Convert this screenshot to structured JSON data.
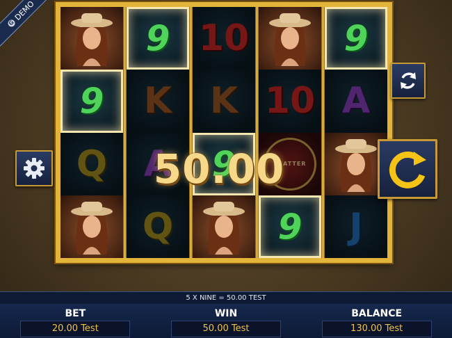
{
  "demo": {
    "label": "DEMO",
    "icon": "gamble-logo-icon"
  },
  "big_win": "50.00",
  "reels": [
    [
      {
        "type": "woman",
        "sym": ""
      },
      {
        "type": "nine",
        "sym": "9",
        "win": true
      },
      {
        "type": "q",
        "sym": "Q",
        "dim": true
      },
      {
        "type": "woman",
        "sym": ""
      }
    ],
    [
      {
        "type": "nine",
        "sym": "9",
        "win": true
      },
      {
        "type": "k",
        "sym": "K",
        "dim": true
      },
      {
        "type": "a",
        "sym": "A",
        "dim": true
      },
      {
        "type": "q",
        "sym": "Q",
        "dim": true
      }
    ],
    [
      {
        "type": "ten",
        "sym": "10",
        "dim": true
      },
      {
        "type": "k",
        "sym": "K",
        "dim": true
      },
      {
        "type": "nine",
        "sym": "9",
        "win": true
      },
      {
        "type": "woman",
        "sym": ""
      }
    ],
    [
      {
        "type": "woman",
        "sym": ""
      },
      {
        "type": "ten",
        "sym": "10",
        "dim": true
      },
      {
        "type": "scatter",
        "sym": "SCATTER",
        "dim": true
      },
      {
        "type": "nine",
        "sym": "9",
        "win": true
      }
    ],
    [
      {
        "type": "nine",
        "sym": "9",
        "win": true
      },
      {
        "type": "a",
        "sym": "A",
        "dim": true
      },
      {
        "type": "woman",
        "sym": ""
      },
      {
        "type": "j",
        "sym": "J",
        "dim": true
      }
    ]
  ],
  "buttons": {
    "settings": "gear-icon",
    "autoplay": "autoplay-cycle-icon",
    "spin": "spin-arrow-icon"
  },
  "win_line": "5 X NINE = 50.00 TEST",
  "bottom": {
    "bet_label": "BET",
    "bet_value": "20.00 Test",
    "win_label": "WIN",
    "win_value": "50.00 Test",
    "balance_label": "BALANCE",
    "balance_value": "130.00 Test"
  },
  "colors": {
    "frame_gold": "#e2b53a",
    "value_gold": "#f0c24a",
    "nine_green": "#4fd35a"
  }
}
